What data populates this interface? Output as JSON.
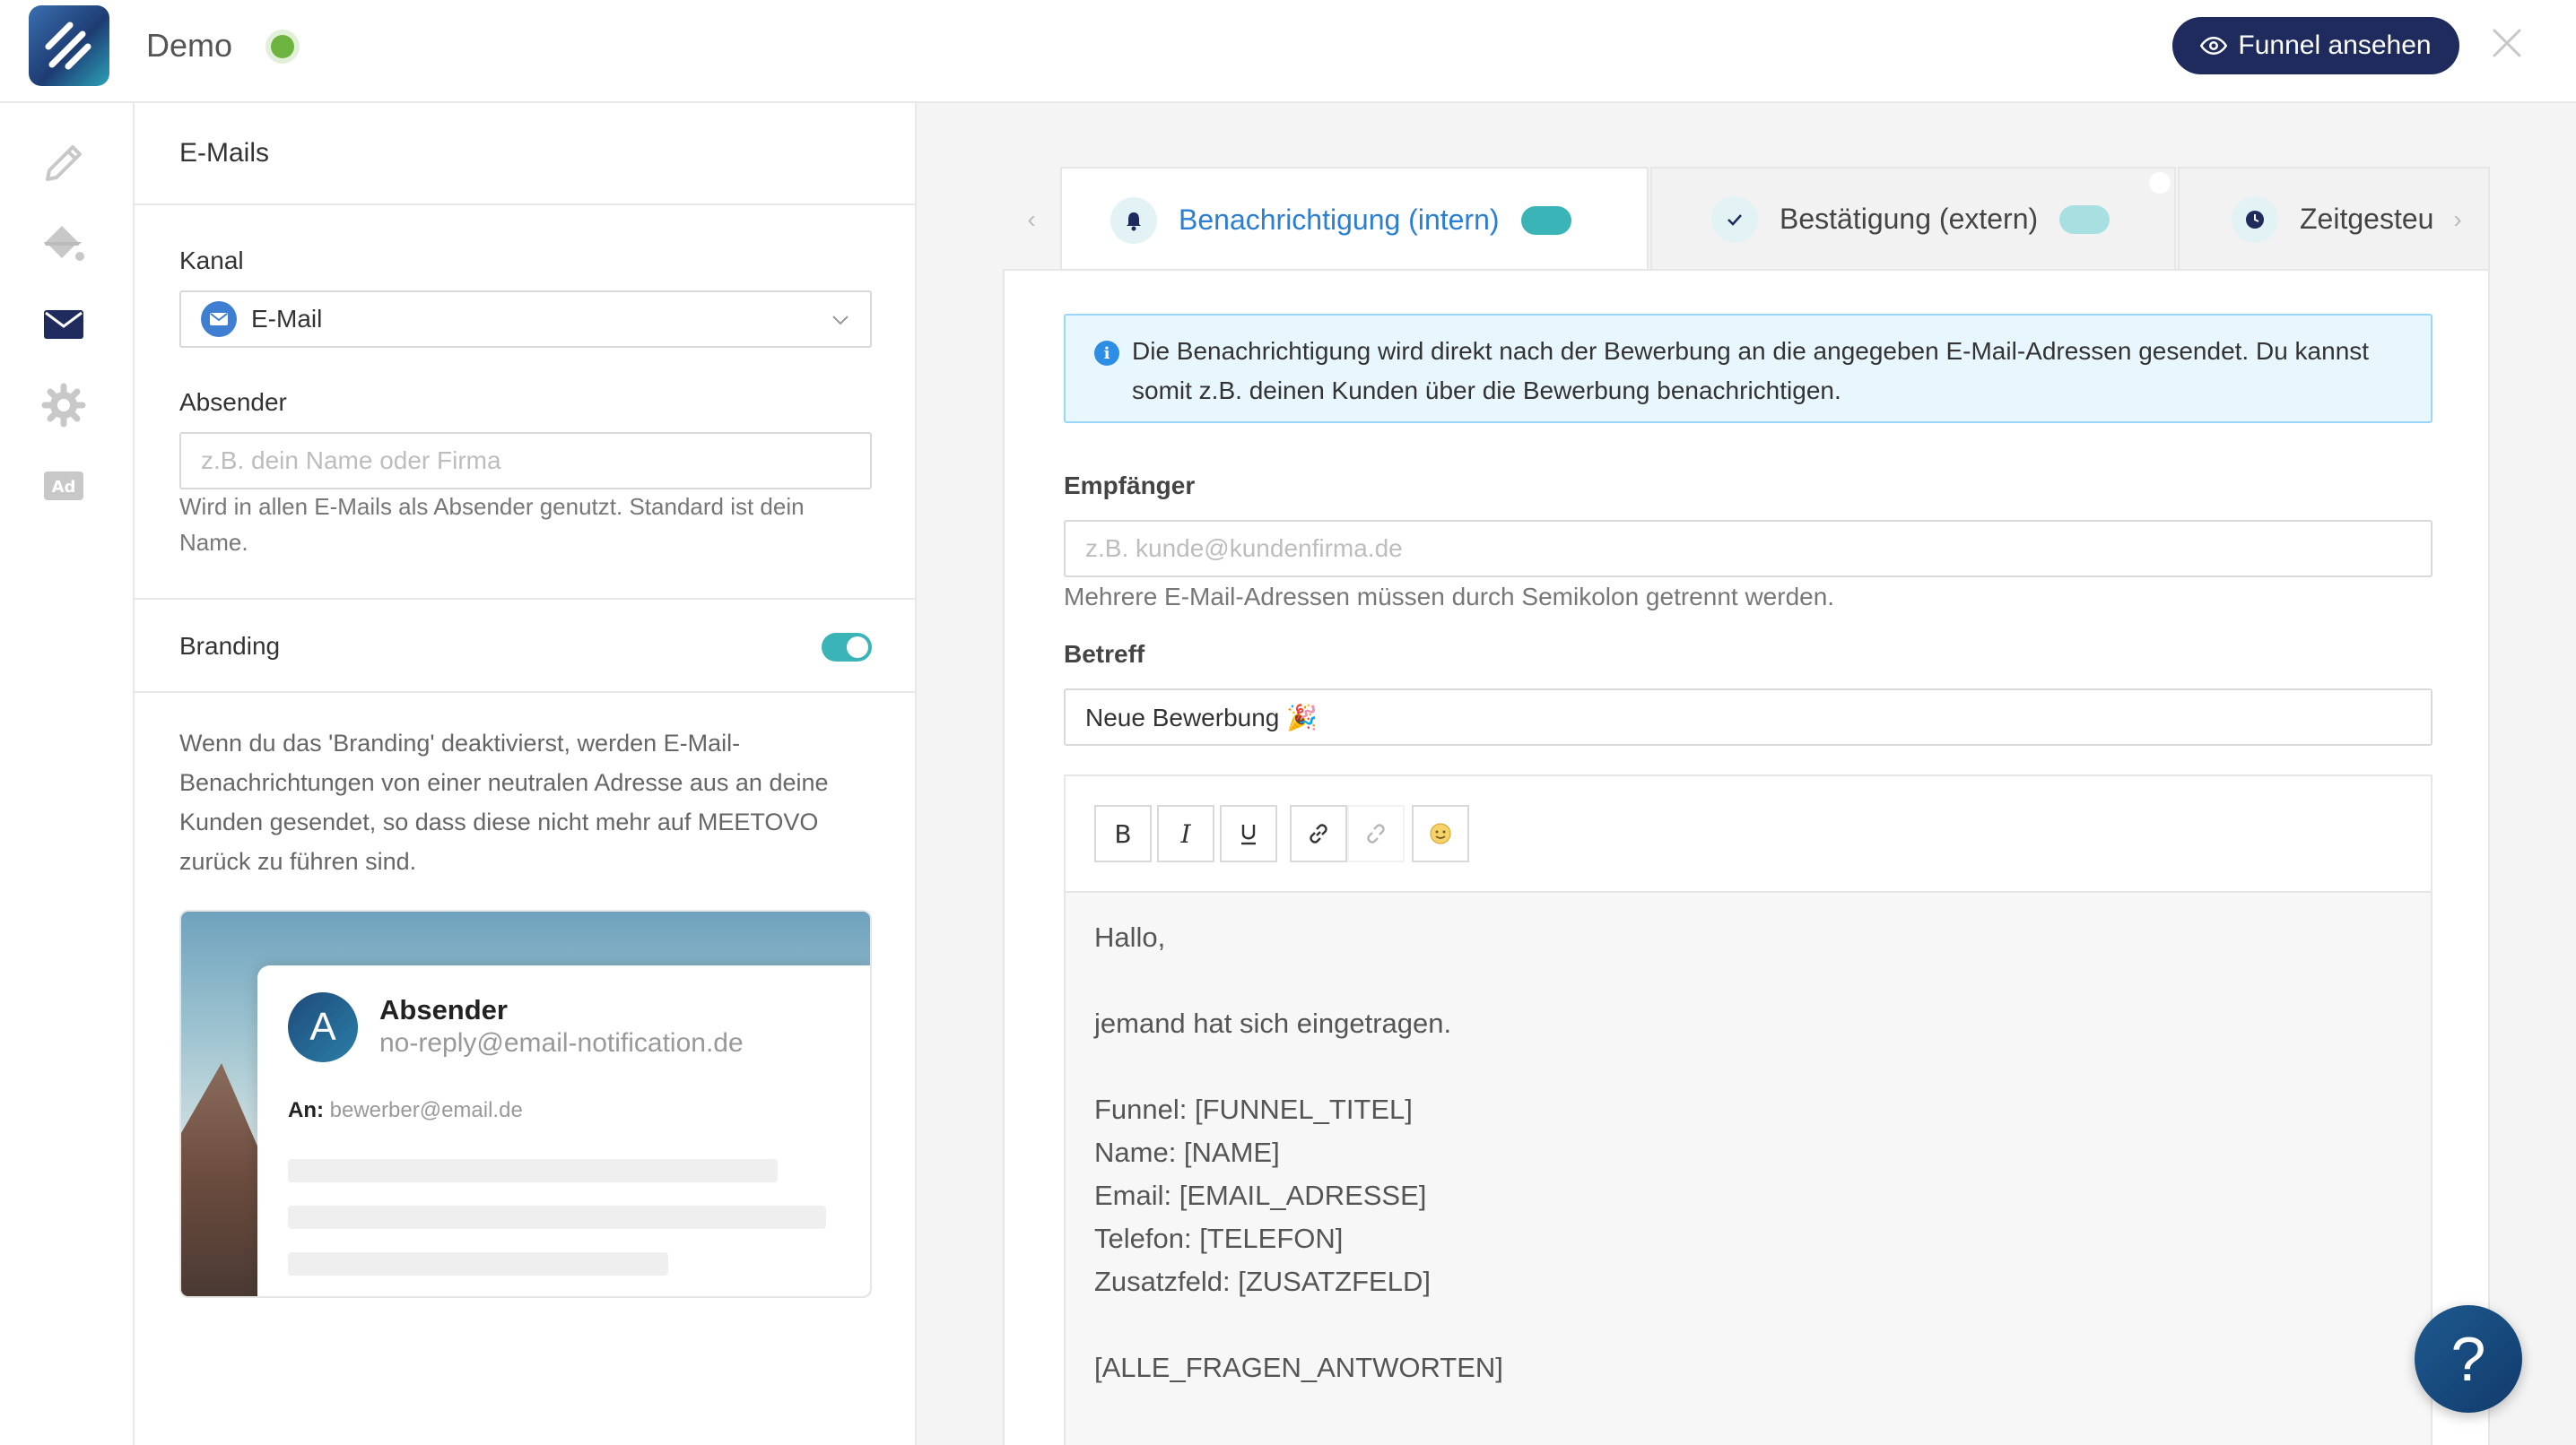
{
  "header": {
    "app_title": "Demo",
    "status_color": "#6db33f",
    "funnel_button_label": "Funnel ansehen",
    "brand_color": "#1e2b5c"
  },
  "rail": {
    "icons": [
      "pencil-icon",
      "paint-bucket-icon",
      "envelope-icon",
      "gear-icon",
      "ad-icon"
    ],
    "active": "envelope-icon"
  },
  "panel": {
    "title": "E-Mails",
    "kanal_label": "Kanal",
    "kanal_value": "E-Mail",
    "absender_label": "Absender",
    "absender_placeholder": "z.B. dein Name oder Firma",
    "absender_help": "Wird in allen E-Mails als Absender genutzt. Standard ist dein Name.",
    "branding_label": "Branding",
    "branding_enabled": true,
    "branding_text": "Wenn du das 'Branding' deaktivierst, werden E-Mail-Benachrichtungen von einer neutralen Adresse aus an deine Kunden gesendet, so dass diese nicht mehr auf MEETOVO zurück zu führen sind.",
    "preview": {
      "avatar_letter": "A",
      "sender_name": "Absender",
      "sender_email": "no-reply@email-notification.de",
      "to_label": "An:",
      "to_value": "bewerber@email.de"
    }
  },
  "tabs": [
    {
      "label": "Benachrichtigung (intern)",
      "icon": "bell-icon",
      "active": true,
      "enabled": true
    },
    {
      "label": "Bestätigung (extern)",
      "icon": "check-icon",
      "active": false,
      "enabled": true
    },
    {
      "label": "Zeitgesteu",
      "icon": "clock-icon",
      "active": false
    }
  ],
  "main": {
    "info_text": "Die Benachrichtigung wird direkt nach der Bewerbung an die angegeben E-Mail-Adressen gesendet. Du kannst somit z.B. deinen Kunden über die Bewerbung benachrichtigen.",
    "recipient_label": "Empfänger",
    "recipient_placeholder": "z.B. kunde@kundenfirma.de",
    "recipient_help": "Mehrere E-Mail-Adressen müssen durch Semikolon getrennt werden.",
    "subject_label": "Betreff",
    "subject_value": "Neue Bewerbung 🎉",
    "toolbar": [
      "bold-icon",
      "italic-icon",
      "underline-icon",
      "link-icon",
      "unlink-icon",
      "emoji-icon"
    ],
    "body_lines": [
      "Hallo,",
      "",
      "jemand hat sich eingetragen.",
      "",
      "Funnel: [FUNNEL_TITEL]",
      "Name: [NAME]",
      "Email: [EMAIL_ADRESSE]",
      "Telefon: [TELEFON]",
      "Zusatzfeld: [ZUSATZFELD]",
      "",
      "[ALLE_FRAGEN_ANTWORTEN]"
    ]
  },
  "help_button_label": "?"
}
